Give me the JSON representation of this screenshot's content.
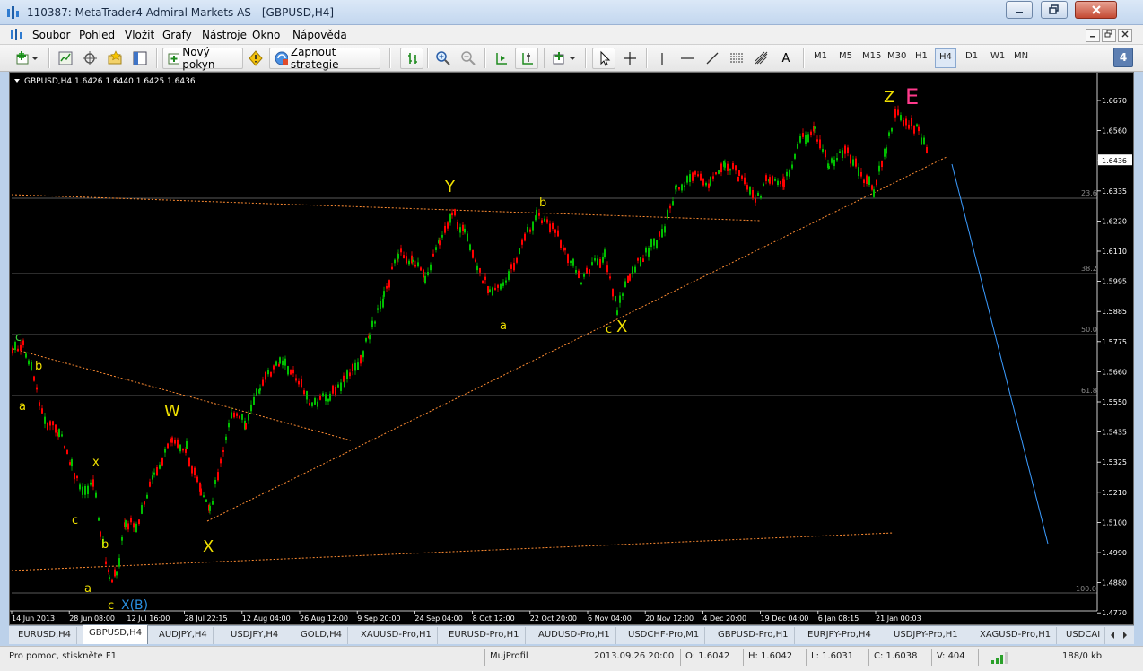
{
  "window": {
    "title": "110387: MetaTrader4 Admiral Markets AS - [GBPUSD,H4]"
  },
  "menu": [
    "Soubor",
    "Pohled",
    "Vložit",
    "Grafy",
    "Nástroje",
    "Okno",
    "Nápověda"
  ],
  "toolbar": {
    "new_order": "Nový pokyn",
    "autotrading": "Zapnout strategie",
    "timeframes": [
      "M1",
      "M5",
      "M15",
      "M30",
      "H1",
      "H4",
      "D1",
      "W1",
      "MN"
    ],
    "active_timeframe": "H4",
    "text_tool": "A",
    "badge": "4"
  },
  "chart": {
    "header": "GBPUSD,H4  1.6426 1.6440 1.6425 1.6436",
    "price_ticks": [
      "1.6670",
      "1.6560",
      "1.6436",
      "1.6335",
      "1.6220",
      "1.6110",
      "1.5995",
      "1.5885",
      "1.5775",
      "1.5660",
      "1.5550",
      "1.5435",
      "1.5325",
      "1.5210",
      "1.5100",
      "1.4990",
      "1.4880",
      "1.4770"
    ],
    "date_ticks": [
      "14 Jun 2013",
      "28 Jun 08:00",
      "12 Jul 16:00",
      "28 Jul 22:15",
      "12 Aug 04:00",
      "26 Aug 12:00",
      "9 Sep 20:00",
      "24 Sep 04:00",
      "8 Oct 12:00",
      "22 Oct 20:00",
      "6 Nov 04:00",
      "20 Nov 12:00",
      "4 Dec 20:00",
      "19 Dec 04:00",
      "6 Jan 08:15",
      "21 Jan 00:03"
    ],
    "fib_levels": [
      "23.6",
      "38.2",
      "50.0",
      "61.8",
      "100.0"
    ],
    "wave_labels": {
      "c1": "c",
      "b1": "b",
      "a1": "a",
      "c2": "c",
      "x1": "x",
      "b2": "b",
      "a2": "a",
      "c3": "c",
      "xb": "X(B)",
      "w": "W",
      "x2": "X",
      "y": "Y",
      "b3": "b",
      "a3": "a",
      "cx": "c",
      "x3": "X",
      "z": "Z",
      "e": "E"
    },
    "colors": {
      "up": "#00c000",
      "down": "#ff0000",
      "wave": "#f0e000",
      "e_label": "#ff3a8c",
      "xb_label": "#2a8fe0",
      "trend": "#ff8c32",
      "projection": "#3b9cff",
      "grid": "#ffffff",
      "axis_text": "#ffffff"
    }
  },
  "tabs": [
    "EURUSD,H4",
    "GBPUSD,H4",
    "AUDJPY,H4",
    "USDJPY,H4",
    "GOLD,H4",
    "XAUUSD-Pro,H1",
    "EURUSD-Pro,H1",
    "AUDUSD-Pro,H1",
    "USDCHF-Pro,M1",
    "GBPUSD-Pro,H1",
    "EURJPY-Pro,H4",
    "USDJPY-Pro,H1",
    "XAGUSD-Pro,H1",
    "USDCAI"
  ],
  "status": {
    "help": "Pro pomoc, stiskněte F1",
    "profile": "MujProfil",
    "datetime": "2013.09.26 20:00",
    "open": "O: 1.6042",
    "high": "H: 1.6042",
    "low": "L: 1.6031",
    "close": "C: 1.6038",
    "volume": "V: 404",
    "traffic": "188/0 kb"
  }
}
